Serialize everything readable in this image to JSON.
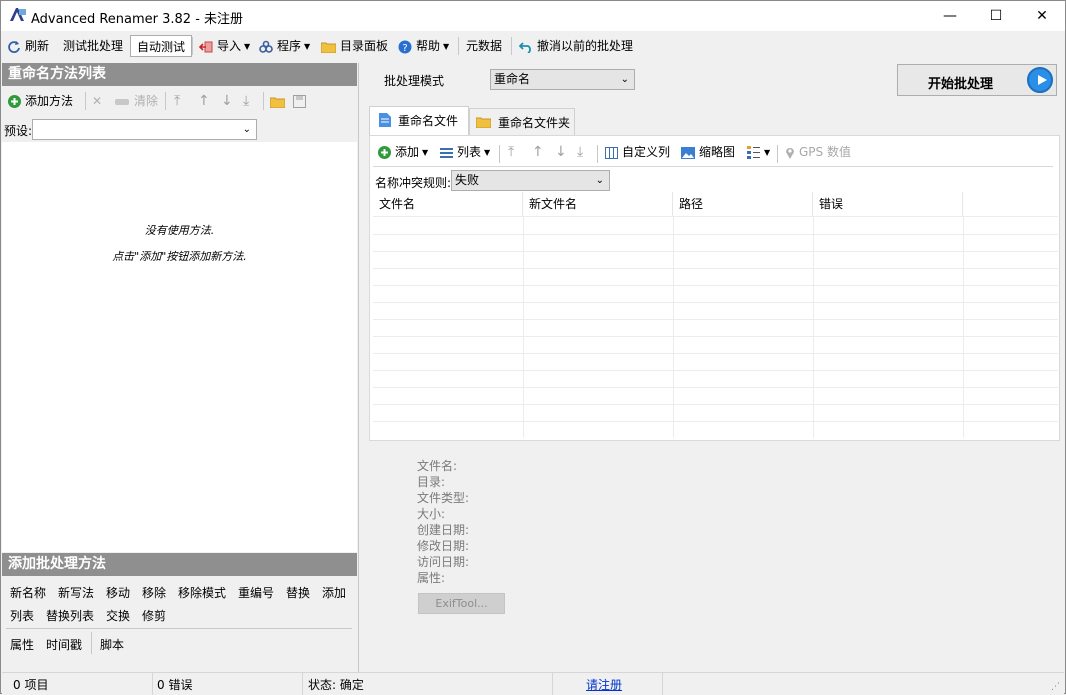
{
  "window": {
    "title": "Advanced Renamer 3.82 - 未注册",
    "minimize": "—",
    "maximize": "☐",
    "close": "✕"
  },
  "toolbar": {
    "refresh": "刷新",
    "test_batch": "测试批处理",
    "auto_test": "自动测试",
    "import": "导入",
    "programs": "程序",
    "dir_panel": "目录面板",
    "help": "帮助",
    "metadata": "元数据",
    "undo_batch": "撤消以前的批处理"
  },
  "left_panel": {
    "title": "重命名方法列表",
    "add_method": "添加方法",
    "clear": "清除",
    "preset_label": "预设:",
    "preset_value": "",
    "empty_line1": "没有使用方法.",
    "empty_line2": "点击\"添加\"按钮添加新方法."
  },
  "methods_panel": {
    "title": "添加批处理方法",
    "row1": [
      "新名称",
      "新写法",
      "移动",
      "移除",
      "移除模式",
      "重编号",
      "替换",
      "添加"
    ],
    "row2": [
      "列表",
      "替换列表",
      "交换",
      "修剪"
    ],
    "row3": [
      "属性",
      "时间戳",
      "脚本"
    ]
  },
  "batch": {
    "mode_label": "批处理模式",
    "mode_value": "重命名",
    "start_button": "开始批处理"
  },
  "tabs": {
    "files": "重命名文件",
    "folders": "重命名文件夹"
  },
  "file_toolbar": {
    "add": "添加",
    "list": "列表",
    "custom_columns": "自定义列",
    "thumbnails": "缩略图",
    "gps": "GPS 数值"
  },
  "conflict": {
    "label": "名称冲突规则:",
    "value": "失败"
  },
  "grid": {
    "columns": [
      "文件名",
      "新文件名",
      "路径",
      "错误"
    ]
  },
  "info": {
    "labels": [
      "文件名:",
      "目录:",
      "文件类型:",
      "大小:",
      "创建日期:",
      "修改日期:",
      "访问日期:",
      "属性:"
    ],
    "exif_button": "ExifTool..."
  },
  "status": {
    "items": "0 项目",
    "errors": "0 错误",
    "state": "状态: 确定",
    "register": "请注册"
  },
  "colors": {
    "panel_header": "#8f8f8f",
    "accent": "#2b8fe6",
    "link": "#0033cc"
  }
}
